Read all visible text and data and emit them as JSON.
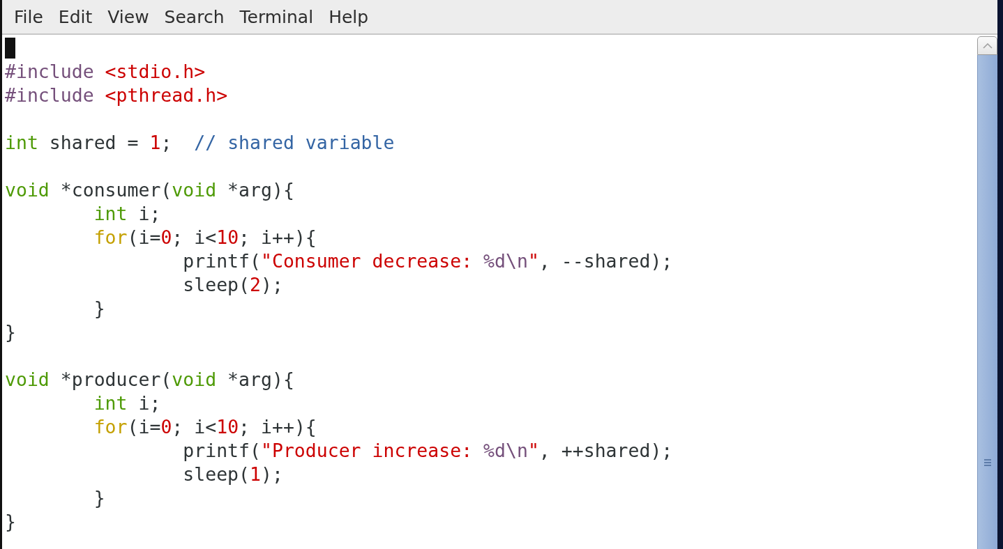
{
  "menu": [
    {
      "label": "File"
    },
    {
      "label": "Edit"
    },
    {
      "label": "View"
    },
    {
      "label": "Search"
    },
    {
      "label": "Terminal"
    },
    {
      "label": "Help"
    }
  ],
  "lines": [
    {
      "kind": "blank",
      "cursor": true
    },
    {
      "kind": "code",
      "cursor": false,
      "tokens": [
        {
          "kind": "preproc",
          "text": "#include "
        },
        {
          "kind": "string",
          "text": "<stdio.h>"
        }
      ]
    },
    {
      "kind": "code",
      "cursor": false,
      "tokens": [
        {
          "kind": "preproc",
          "text": "#include "
        },
        {
          "kind": "string",
          "text": "<pthread.h>"
        }
      ]
    },
    {
      "kind": "blank",
      "cursor": false
    },
    {
      "kind": "code",
      "cursor": false,
      "tokens": [
        {
          "kind": "type",
          "text": "int"
        },
        {
          "kind": "plain",
          "text": " shared = "
        },
        {
          "kind": "number",
          "text": "1"
        },
        {
          "kind": "plain",
          "text": ";  "
        },
        {
          "kind": "comment",
          "text": "// shared variable"
        }
      ]
    },
    {
      "kind": "blank",
      "cursor": false
    },
    {
      "kind": "code",
      "cursor": false,
      "tokens": [
        {
          "kind": "type",
          "text": "void"
        },
        {
          "kind": "plain",
          "text": " *consumer("
        },
        {
          "kind": "type",
          "text": "void"
        },
        {
          "kind": "plain",
          "text": " *arg){"
        }
      ]
    },
    {
      "kind": "code",
      "cursor": false,
      "tokens": [
        {
          "kind": "type",
          "text": "\tint"
        },
        {
          "kind": "plain",
          "text": " i;"
        }
      ]
    },
    {
      "kind": "code",
      "cursor": false,
      "tokens": [
        {
          "kind": "keyword",
          "text": "\tfor"
        },
        {
          "kind": "plain",
          "text": "(i="
        },
        {
          "kind": "number",
          "text": "0"
        },
        {
          "kind": "plain",
          "text": "; i<"
        },
        {
          "kind": "number",
          "text": "10"
        },
        {
          "kind": "plain",
          "text": "; i++){"
        }
      ]
    },
    {
      "kind": "code",
      "cursor": false,
      "tokens": [
        {
          "kind": "plain",
          "text": "\t\tprintf("
        },
        {
          "kind": "string",
          "text": "\"Consumer decrease: "
        },
        {
          "kind": "format",
          "text": "%d\\n"
        },
        {
          "kind": "string",
          "text": "\""
        },
        {
          "kind": "plain",
          "text": ", --shared);"
        }
      ]
    },
    {
      "kind": "code",
      "cursor": false,
      "tokens": [
        {
          "kind": "plain",
          "text": "\t\tsleep("
        },
        {
          "kind": "number",
          "text": "2"
        },
        {
          "kind": "plain",
          "text": ");"
        }
      ]
    },
    {
      "kind": "code",
      "cursor": false,
      "tokens": [
        {
          "kind": "plain",
          "text": "\t}"
        }
      ]
    },
    {
      "kind": "code",
      "cursor": false,
      "tokens": [
        {
          "kind": "plain",
          "text": "}"
        }
      ]
    },
    {
      "kind": "blank",
      "cursor": false
    },
    {
      "kind": "code",
      "cursor": false,
      "tokens": [
        {
          "kind": "type",
          "text": "void"
        },
        {
          "kind": "plain",
          "text": " *producer("
        },
        {
          "kind": "type",
          "text": "void"
        },
        {
          "kind": "plain",
          "text": " *arg){"
        }
      ]
    },
    {
      "kind": "code",
      "cursor": false,
      "tokens": [
        {
          "kind": "type",
          "text": "\tint"
        },
        {
          "kind": "plain",
          "text": " i;"
        }
      ]
    },
    {
      "kind": "code",
      "cursor": false,
      "tokens": [
        {
          "kind": "keyword",
          "text": "\tfor"
        },
        {
          "kind": "plain",
          "text": "(i="
        },
        {
          "kind": "number",
          "text": "0"
        },
        {
          "kind": "plain",
          "text": "; i<"
        },
        {
          "kind": "number",
          "text": "10"
        },
        {
          "kind": "plain",
          "text": "; i++){"
        }
      ]
    },
    {
      "kind": "code",
      "cursor": false,
      "tokens": [
        {
          "kind": "plain",
          "text": "\t\tprintf("
        },
        {
          "kind": "string",
          "text": "\"Producer increase: "
        },
        {
          "kind": "format",
          "text": "%d\\n"
        },
        {
          "kind": "string",
          "text": "\""
        },
        {
          "kind": "plain",
          "text": ", ++shared);"
        }
      ]
    },
    {
      "kind": "code",
      "cursor": false,
      "tokens": [
        {
          "kind": "plain",
          "text": "\t\tsleep("
        },
        {
          "kind": "number",
          "text": "1"
        },
        {
          "kind": "plain",
          "text": ");"
        }
      ]
    },
    {
      "kind": "code",
      "cursor": false,
      "tokens": [
        {
          "kind": "plain",
          "text": "\t}"
        }
      ]
    },
    {
      "kind": "code",
      "cursor": false,
      "tokens": [
        {
          "kind": "plain",
          "text": "}"
        }
      ]
    }
  ]
}
